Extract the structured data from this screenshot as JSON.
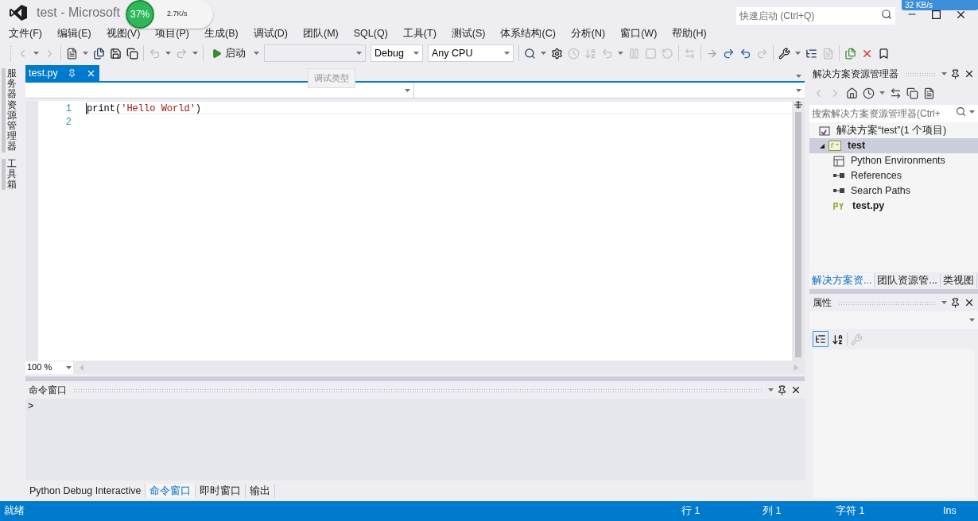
{
  "window": {
    "title": "test - Microsoft"
  },
  "monitor_widget": {
    "percent": "37%",
    "speed": "2.7K/s"
  },
  "network_badge": {
    "speed": "32 KB/s"
  },
  "quick_launch": {
    "placeholder": "快速启动 (Ctrl+Q)"
  },
  "menu": [
    "文件(F)",
    "编辑(E)",
    "视图(V)",
    "项目(P)",
    "生成(B)",
    "调试(D)",
    "团队(M)",
    "SQL(Q)",
    "工具(T)",
    "测试(S)",
    "体系结构(C)",
    "分析(N)",
    "窗口(W)",
    "帮助(H)"
  ],
  "toolbar": {
    "start": "启动",
    "configuration": "Debug",
    "platform": "Any CPU",
    "tooltip": "调试类型"
  },
  "left_rail": [
    "服务器资源管理器",
    "工具箱"
  ],
  "editor": {
    "tabs": [
      {
        "label": "test.py",
        "selected": true
      }
    ],
    "lines": [
      {
        "number": "1",
        "tokens": [
          {
            "kind": "plain",
            "text": "print("
          },
          {
            "kind": "string",
            "text": "'Hello World'"
          },
          {
            "kind": "plain",
            "text": ")"
          }
        ]
      },
      {
        "number": "2"
      }
    ],
    "zoom": "100 %"
  },
  "command_window": {
    "title": "命令窗口",
    "prompt": ">",
    "tabs": [
      {
        "label": "Python Debug Interactive",
        "selected": false
      },
      {
        "label": "命令窗口",
        "selected": true
      },
      {
        "label": "即时窗口",
        "selected": false
      },
      {
        "label": "输出",
        "selected": false
      }
    ]
  },
  "solution_explorer": {
    "title": "解决方案资源管理器",
    "search_placeholder": "搜索解决方案资源管理器(Ctrl+",
    "tree": [
      {
        "label": "解决方案“test”(1 个项目)",
        "kind": "solution",
        "bold": false,
        "selected": false
      },
      {
        "label": "test",
        "kind": "project",
        "bold": true,
        "selected": true,
        "expanded": true,
        "children": [
          {
            "label": "Python Environments",
            "kind": "environments",
            "bold": false,
            "selected": false
          },
          {
            "label": "References",
            "kind": "references",
            "bold": false,
            "selected": false
          },
          {
            "label": "Search Paths",
            "kind": "references",
            "bold": false,
            "selected": false
          },
          {
            "label": "test.py",
            "kind": "pyfile",
            "bold": true,
            "selected": false
          }
        ]
      }
    ],
    "tabs": [
      {
        "label": "解决方案资...",
        "selected": true
      },
      {
        "label": "团队资源管...",
        "selected": false
      },
      {
        "label": "类视图",
        "selected": false
      }
    ]
  },
  "properties": {
    "title": "属性"
  },
  "status_bar": {
    "message": "就绪",
    "line": "行 1",
    "column": "列 1",
    "char": "字符 1",
    "mode": "Ins"
  }
}
